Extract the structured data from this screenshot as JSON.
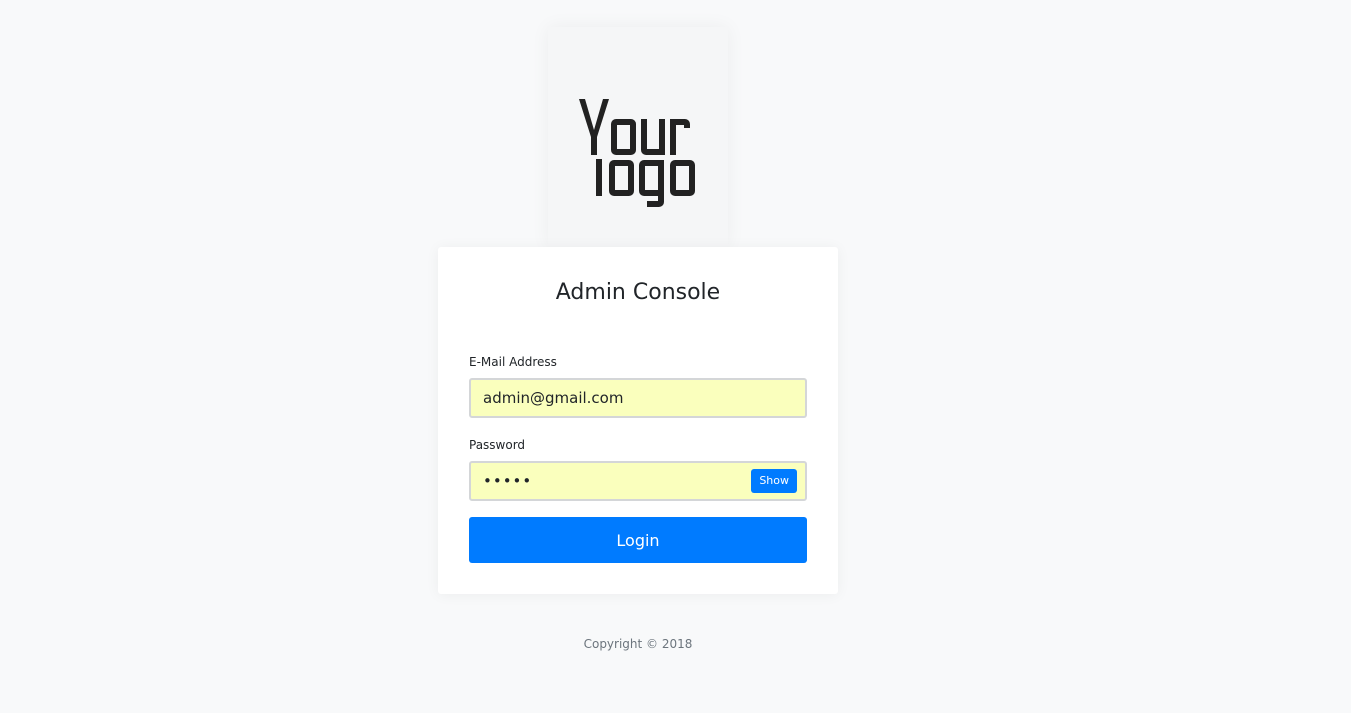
{
  "logo": {
    "line1": "Your",
    "line2": "logo"
  },
  "login": {
    "title": "Admin Console",
    "email_label": "E-Mail Address",
    "email_value": "admin@gmail.com",
    "password_label": "Password",
    "password_value": "admin",
    "show_label": "Show",
    "submit_label": "Login"
  },
  "footer": {
    "copyright": "Copyright © 2018"
  },
  "colors": {
    "primary": "#007bff",
    "autofill": "#faffbd",
    "background": "#f8f9fa"
  }
}
